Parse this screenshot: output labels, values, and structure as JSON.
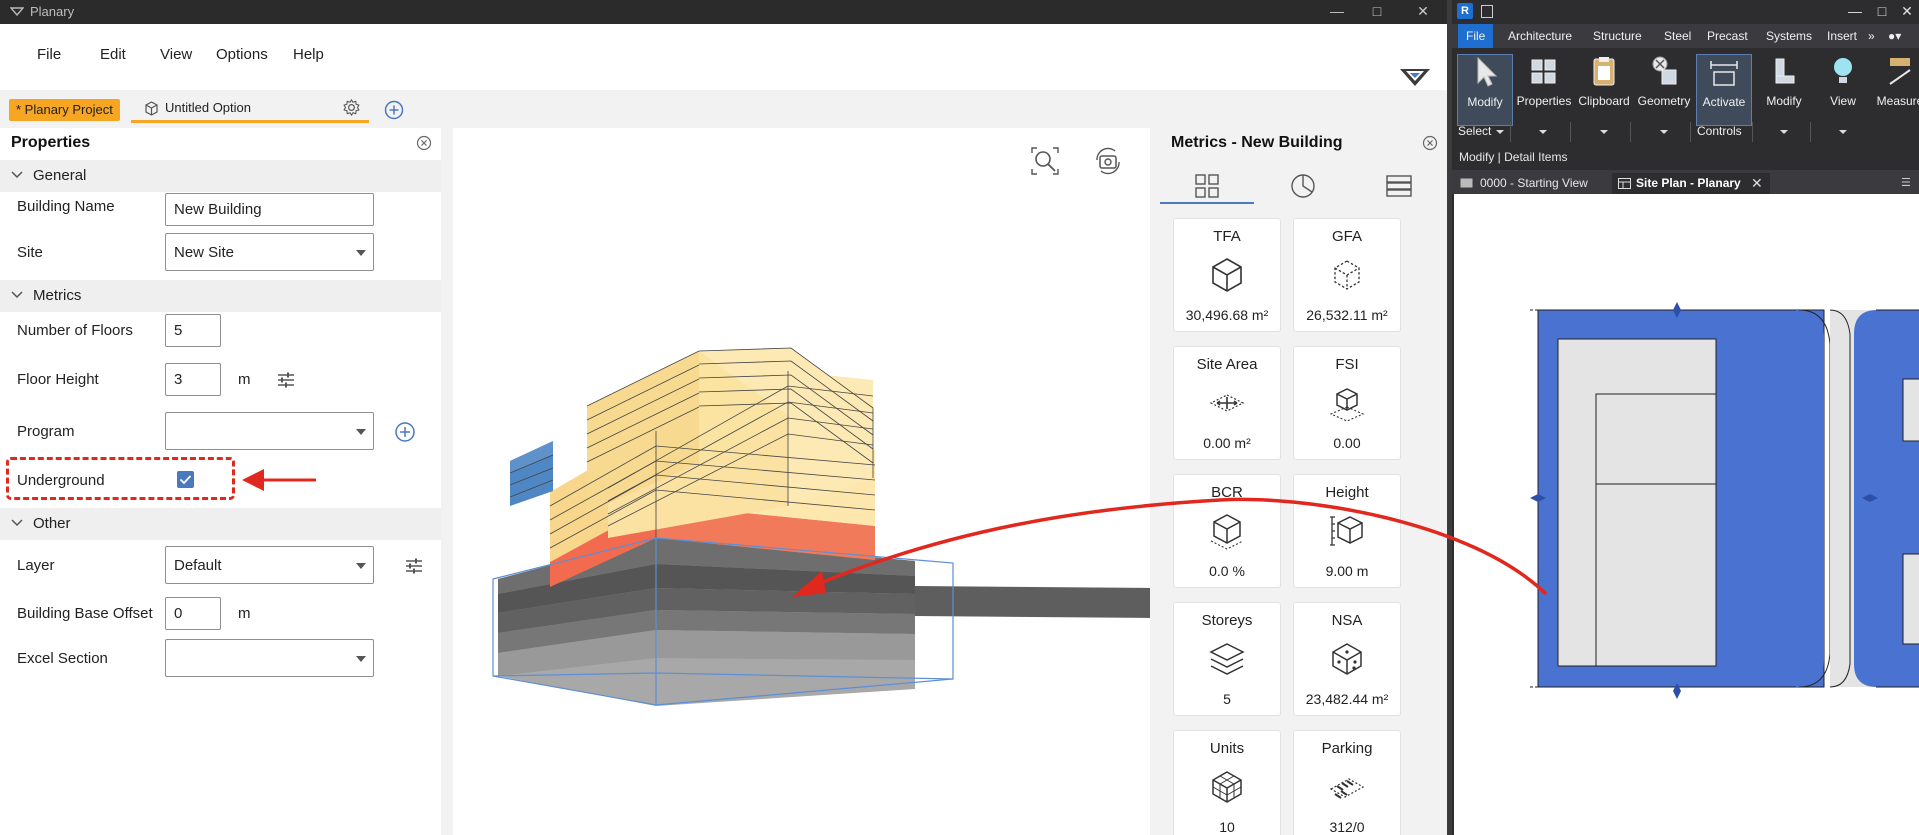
{
  "planary": {
    "window_title": "Planary",
    "menu": [
      "File",
      "Edit",
      "View",
      "Options",
      "Help"
    ],
    "tabs": {
      "project_label": "* Planary Project",
      "option_label": "Untitled Option"
    },
    "properties": {
      "title": "Properties",
      "sections": {
        "general": "General",
        "metrics": "Metrics",
        "other": "Other"
      },
      "fields": {
        "building_name": {
          "label": "Building Name",
          "value": "New Building"
        },
        "site": {
          "label": "Site",
          "value": "New Site"
        },
        "number_of_floors": {
          "label": "Number of Floors",
          "value": "5"
        },
        "floor_height": {
          "label": "Floor Height",
          "value": "3",
          "unit": "m"
        },
        "program": {
          "label": "Program",
          "value": ""
        },
        "underground": {
          "label": "Underground",
          "checked": true
        },
        "layer": {
          "label": "Layer",
          "value": "Default"
        },
        "building_base_offset": {
          "label": "Building Base Offset",
          "value": "0",
          "unit": "m"
        },
        "excel_section": {
          "label": "Excel Section",
          "value": ""
        }
      }
    },
    "metrics": {
      "title": "Metrics - New Building",
      "cards": [
        {
          "title": "TFA",
          "value": "30,496.68 m²",
          "icon": "tfa-cube-icon"
        },
        {
          "title": "GFA",
          "value": "26,532.11 m²",
          "icon": "gfa-cube-icon"
        },
        {
          "title": "Site Area",
          "value": "0.00 m²",
          "icon": "site-area-icon"
        },
        {
          "title": "FSI",
          "value": "0.00",
          "icon": "fsi-icon"
        },
        {
          "title": "BCR",
          "value": "0.0 %",
          "icon": "bcr-icon"
        },
        {
          "title": "Height",
          "value": "9.00 m",
          "icon": "height-icon"
        },
        {
          "title": "Storeys",
          "value": "5",
          "icon": "storeys-layers-icon"
        },
        {
          "title": "NSA",
          "value": "23,482.44 m²",
          "icon": "nsa-icon"
        },
        {
          "title": "Units",
          "value": "10",
          "icon": "units-grid-cube-icon"
        },
        {
          "title": "Parking",
          "value": "312/0",
          "icon": "parking-icon"
        }
      ]
    },
    "colors": {
      "accent_orange": "#f6a623",
      "accent_blue": "#4a79c0",
      "annotation_red": "#e0281e",
      "floor_yellow": "#fbe3a0",
      "floor_red": "#f06e50",
      "underground_grey": "#8c8c8c"
    }
  },
  "revit": {
    "ribbon_tabs": [
      "File",
      "Architecture",
      "Structure",
      "Steel",
      "Precast",
      "Systems",
      "Insert"
    ],
    "ribbon_buttons": [
      "Modify",
      "Properties",
      "Clipboard",
      "Geometry",
      "Activate",
      "Modify",
      "View",
      "Measure"
    ],
    "panel_labels": {
      "select": "Select",
      "controls": "Controls"
    },
    "status_text": "Modify | Detail Items",
    "view_tabs": [
      "0000 - Starting View",
      "Site Plan - Planary"
    ],
    "colors": {
      "file_tab_blue": "#1f6fd1",
      "site_blue": "#4a72d1"
    }
  }
}
